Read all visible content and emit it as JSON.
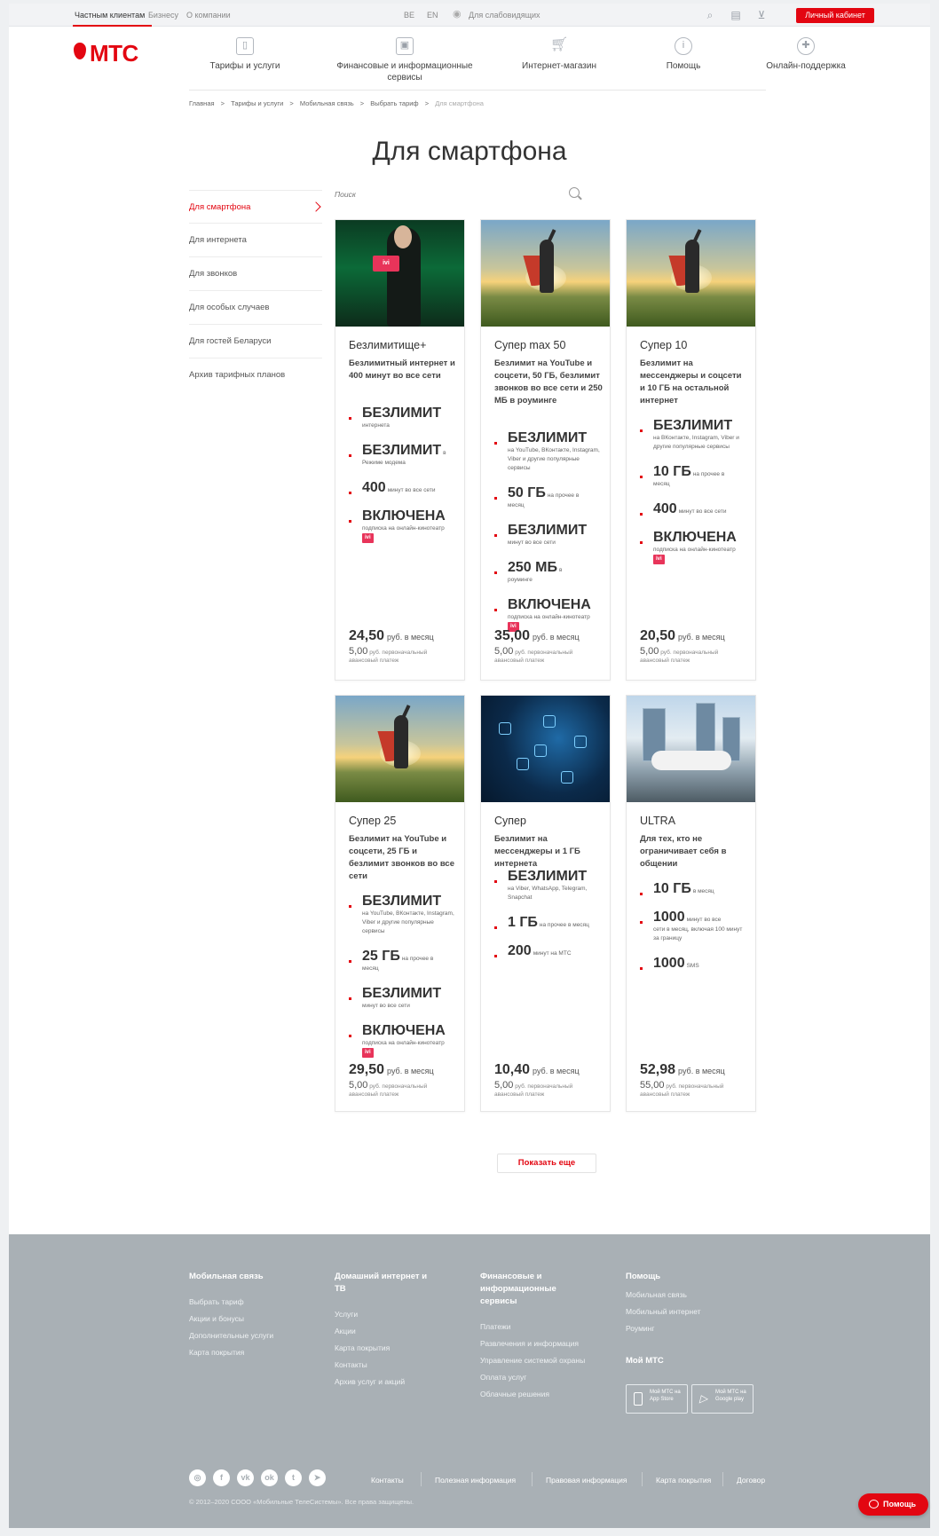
{
  "topbar": {
    "segments": [
      "Частным клиентам",
      "Бизнесу",
      "О компании"
    ],
    "langs": [
      "BE",
      "EN"
    ],
    "accessibility": "Для слабовидящих",
    "cabinet": "Личный кабинет"
  },
  "logo": {
    "text": "МТС"
  },
  "nav": [
    {
      "label": "Тарифы и услуги",
      "icon": "phone-icon"
    },
    {
      "label": "Финансовые и информационные сервисы",
      "icon": "wallet-icon"
    },
    {
      "label": "Интернет-магазин",
      "icon": "cart-icon"
    },
    {
      "label": "Помощь",
      "icon": "info-icon"
    },
    {
      "label": "Онлайн-поддержка",
      "icon": "lifebuoy-icon"
    }
  ],
  "breadcrumbs": [
    "Главная",
    ">",
    "Тарифы и услуги",
    ">",
    "Мобильная связь",
    ">",
    "Выбрать тариф",
    ">",
    "Для смартфона"
  ],
  "page_title": "Для смартфона",
  "sidebar": [
    "Для смартфона",
    "Для интернета",
    "Для звонков",
    "Для особых случаев",
    "Для гостей Беларуси",
    "Архив тарифных планов"
  ],
  "search": {
    "placeholder": "Поиск"
  },
  "cards": [
    {
      "title": "Безлимитище+",
      "desc": "Безлимитный интернет и 400 минут во все сети",
      "image": "matrix-man-ivi",
      "features": [
        {
          "big": "БЕЗЛИМИТ",
          "small": "",
          "sub": "интернета",
          "ivi": ""
        },
        {
          "big": "БЕЗЛИМИТ",
          "small": "в",
          "sub": "Режиме модема",
          "ivi": ""
        },
        {
          "big": "400",
          "small": "минут во все сети",
          "sub": "",
          "ivi": ""
        },
        {
          "big": "ВКЛЮЧЕНА",
          "small": "",
          "sub": "подписка на онлайн-кинотеатр",
          "ivi": "ivi"
        }
      ],
      "price": "24,50",
      "price_unit": "руб. в месяц",
      "adv_amount": "5,00",
      "adv_text": "руб. первоначальный авансовый платеж"
    },
    {
      "title": "Супер max 50",
      "desc": "Безлимит на YouTube и соцсети, 50 ГБ, безлимит звонков во все сети и 250 МБ в роуминге",
      "image": "hero-kid",
      "features": [
        {
          "big": "БЕЗЛИМИТ",
          "small": "",
          "sub": "на YouTube, ВКонтакте, Instagram, Viber и другие популярные сервисы",
          "ivi": ""
        },
        {
          "big": "50 ГБ",
          "small": "на прочее в",
          "sub": "месяц",
          "ivi": ""
        },
        {
          "big": "БЕЗЛИМИТ",
          "small": "",
          "sub": "минут во все сети",
          "ivi": ""
        },
        {
          "big": "250 МБ",
          "small": "в",
          "sub": "роуминге",
          "ivi": ""
        },
        {
          "big": "ВКЛЮЧЕНА",
          "small": "",
          "sub": "подписка на онлайн-кинотеатр",
          "ivi": "ivi"
        }
      ],
      "price": "35,00",
      "price_unit": "руб. в месяц",
      "adv_amount": "5,00",
      "adv_text": "руб. первоначальный авансовый платеж"
    },
    {
      "title": "Супер 10",
      "desc": "Безлимит на мессенджеры и соцсети и 10 ГБ на остальной интернет",
      "image": "hero-kid",
      "features": [
        {
          "big": "БЕЗЛИМИТ",
          "small": "",
          "sub": "на ВКонтакте, Instagram, Viber и другие популярные сервисы",
          "ivi": ""
        },
        {
          "big": "10 ГБ",
          "small": "на прочее в",
          "sub": "месяц",
          "ivi": ""
        },
        {
          "big": "400",
          "small": "минут во все сети",
          "sub": "",
          "ivi": ""
        },
        {
          "big": "ВКЛЮЧЕНА",
          "small": "",
          "sub": "подписка на онлайн-кинотеатр",
          "ivi": "ivi"
        }
      ],
      "price": "20,50",
      "price_unit": "руб. в месяц",
      "adv_amount": "5,00",
      "adv_text": "руб. первоначальный авансовый платеж"
    },
    {
      "title": "Супер 25",
      "desc": "Безлимит на YouTube и соцсети, 25 ГБ и безлимит звонков во все сети",
      "image": "hero-kid",
      "features": [
        {
          "big": "БЕЗЛИМИТ",
          "small": "",
          "sub": "на YouTube, ВКонтакте, Instagram, Viber и другие популярные сервисы",
          "ivi": ""
        },
        {
          "big": "25 ГБ",
          "small": "на прочее в",
          "sub": "месяц",
          "ivi": ""
        },
        {
          "big": "БЕЗЛИМИТ",
          "small": "",
          "sub": "минут во все сети",
          "ivi": ""
        },
        {
          "big": "ВКЛЮЧЕНА",
          "small": "",
          "sub": "подписка на онлайн-кинотеатр",
          "ivi": "ivi"
        }
      ],
      "price": "29,50",
      "price_unit": "руб. в месяц",
      "adv_amount": "5,00",
      "adv_text": "руб. первоначальный авансовый платеж"
    },
    {
      "title": "Супер",
      "desc": "Безлимит на мессенджеры и 1 ГБ интернета",
      "image": "tech-network",
      "features": [
        {
          "big": "БЕЗЛИМИТ",
          "small": "",
          "sub": "на Viber, WhatsApp, Telegram, Snapchat",
          "ivi": ""
        },
        {
          "big": "1 ГБ",
          "small": "на прочее в месяц",
          "sub": "",
          "ivi": ""
        },
        {
          "big": "200",
          "small": "минут на МТС",
          "sub": "",
          "ivi": ""
        }
      ],
      "price": "10,40",
      "price_unit": "руб. в месяц",
      "adv_amount": "5,00",
      "adv_text": "руб. первоначальный авансовый платеж"
    },
    {
      "title": "ULTRA",
      "desc": "Для тех, кто не ограничивает себя в общении",
      "image": "city-plane",
      "features": [
        {
          "big": "10 ГБ",
          "small": "в месяц",
          "sub": "",
          "ivi": ""
        },
        {
          "big": "1000",
          "small": "минут во все",
          "sub": "сети в месяц, включая 100 минут за границу",
          "ivi": ""
        },
        {
          "big": "1000",
          "small": "SMS",
          "sub": "",
          "ivi": ""
        }
      ],
      "price": "52,98",
      "price_unit": "руб. в месяц",
      "adv_amount": "55,00",
      "adv_text": "руб. первоначальный авансовый платеж"
    }
  ],
  "more_button": "Показать еще",
  "footer": {
    "cols": [
      {
        "title": "Мобильная связь",
        "links": [
          "Выбрать тариф",
          "Акции и бонусы",
          "Дополнительные услуги",
          "Карта покрытия"
        ]
      },
      {
        "title": "Домашний интернет и ТВ",
        "links": [
          "Услуги",
          "Акции",
          "Карта покрытия",
          "Контакты",
          "Архив услуг и акций"
        ]
      },
      {
        "title": "Финансовые и информационные сервисы",
        "links": [
          "Платежи",
          "Развлечения и информация",
          "Управление системой охраны",
          "Оплата услуг",
          "Облачные решения"
        ]
      },
      {
        "title": "Помощь",
        "links": [
          "Мобильная связь",
          "Мобильный интернет",
          "Роуминг"
        ]
      }
    ],
    "app_title": "Мой МТС",
    "apps": [
      {
        "label": "Мой МТС на App Store",
        "icon": "apple-phone-icon"
      },
      {
        "label": "Мой МТС на Google play",
        "icon": "google-play-icon"
      }
    ],
    "social": [
      "instagram-icon",
      "facebook-icon",
      "vk-icon",
      "odnoklassniki-icon",
      "twitter-icon",
      "telegram-icon"
    ],
    "bottom_links": [
      "Контакты",
      "Полезная информация",
      "Правовая информация",
      "Карта покрытия",
      "Договор"
    ],
    "copyright": "© 2012–2020 СООО «Мобильные ТелеСистемы». Все права защищены."
  },
  "help_button": "Помощь",
  "colors": {
    "accent": "#e30611",
    "footer_bg": "#a9b0b5"
  }
}
